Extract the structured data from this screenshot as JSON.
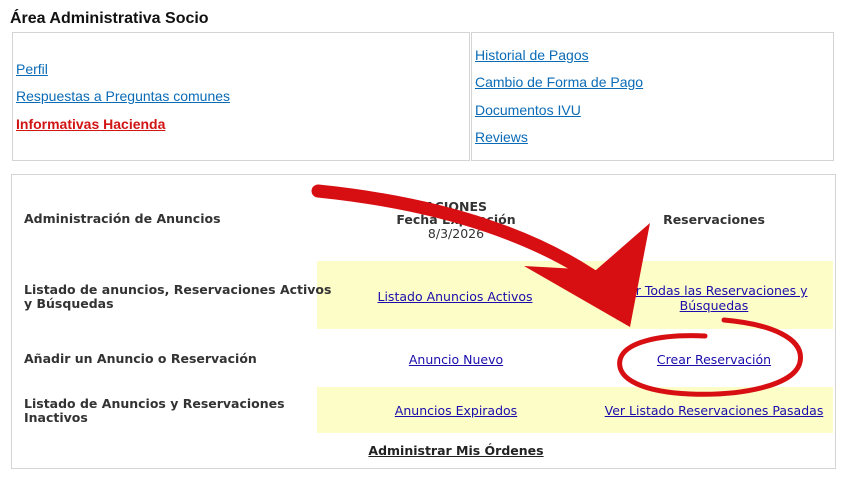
{
  "page": {
    "title": "Área Administrativa Socio"
  },
  "left_links": [
    "Perfil",
    "Respuestas a Preguntas comunes",
    "Informativas Hacienda"
  ],
  "right_links": [
    "Historial de Pagos",
    "Cambio de Forma de Pago",
    "Documentos IVU",
    "Reviews"
  ],
  "table": {
    "row0": {
      "label": "Administración de Anuncios",
      "col_head_line1": "ACIONES",
      "col_head_line2": "Fecha Expiración",
      "date": "8/3/2026",
      "reservations_head": "Reservaciones"
    },
    "row1": {
      "label_line1": "Listado de anuncios, Reservaciones Activos",
      "label_line2": "y Búsquedas",
      "ads_link": "Listado Anuncios Activos",
      "res_link_line1": "Ver Todas las Reservaciones y",
      "res_link_line2": "Búsquedas"
    },
    "row2": {
      "label": "Añadir un Anuncio o Reservación",
      "ads_link": "Anuncio Nuevo",
      "res_link": "Crear Reservación"
    },
    "row3": {
      "label_line1": "Listado de Anuncios y Reservaciones",
      "label_line2": "Inactivos",
      "ads_link": "Anuncios Expirados",
      "res_link": "Ver Listado Reservaciones Pasadas"
    },
    "footer_link": "Administrar Mis Órdenes"
  },
  "annotation_color": "#d80f12"
}
